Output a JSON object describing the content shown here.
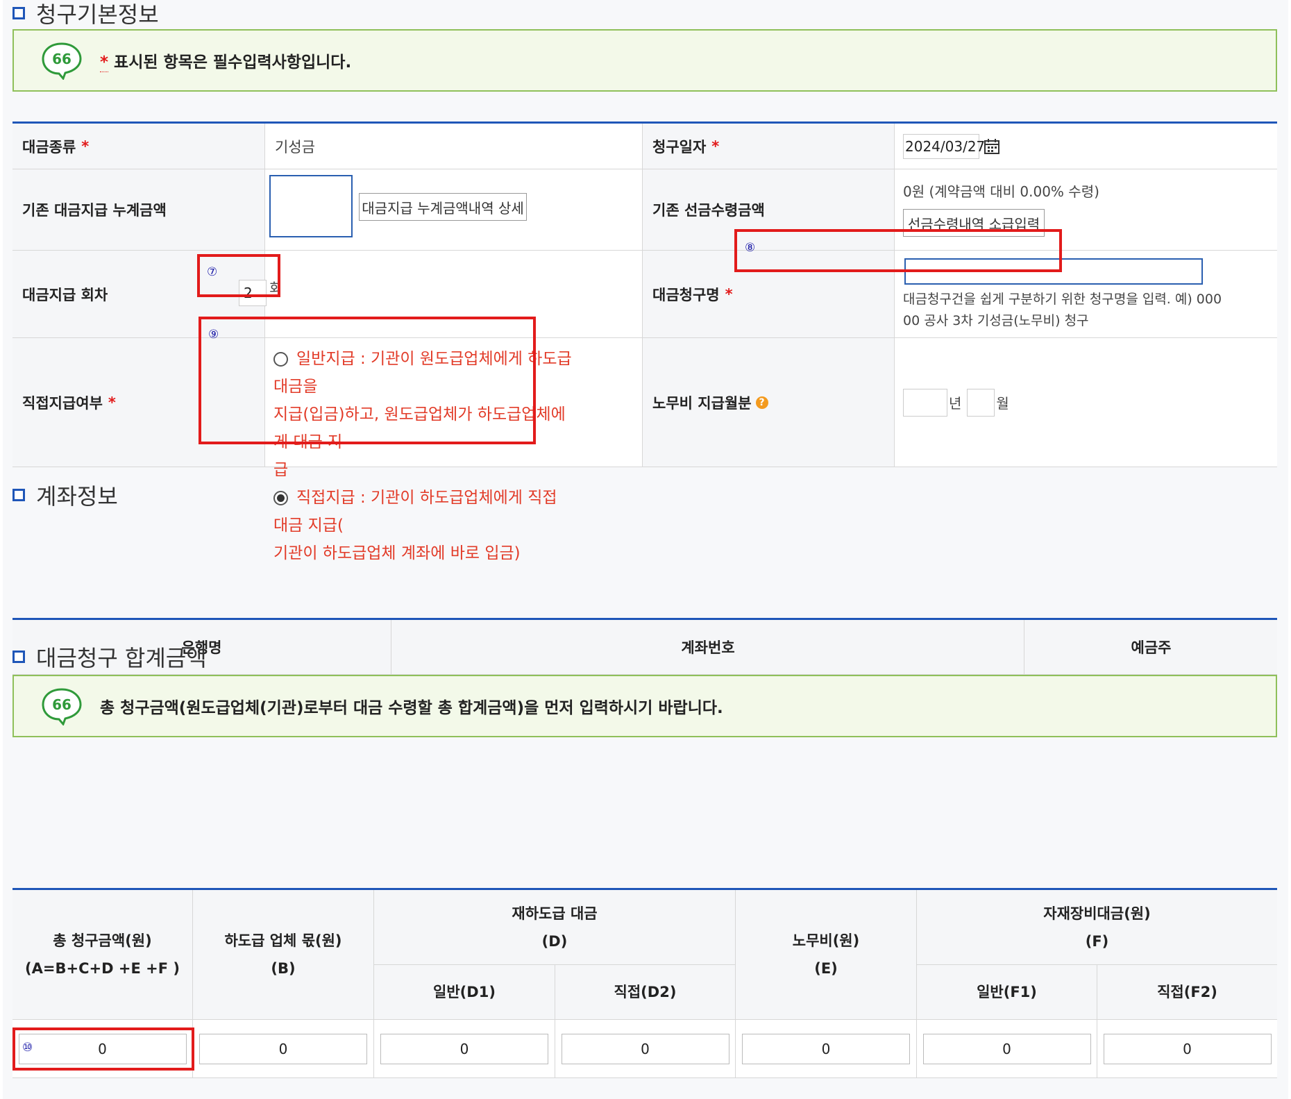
{
  "section1": {
    "title": "청구기본정보",
    "notice": {
      "star": "*",
      "text": "표시된 항목은 필수입력사항입니다."
    },
    "rows": {
      "type_label": "대금종류",
      "type_value": "기성금",
      "date_label": "청구일자",
      "date_value": "2024/03/27",
      "cum_label": "기존 대금지급 누계금액",
      "cum_button": "대금지급 누계금액내역 상세",
      "advance_label": "기존 선금수령금액",
      "advance_value": "0원 (계약금액 대비 0.00% 수령)",
      "advance_button": "선금수령내역 소급입력",
      "round_label": "대금지급 회차",
      "round_value": "2",
      "round_unit": "회",
      "claim_name_label": "대금청구명",
      "claim_name_help_1": "대금청구건을 쉽게 구분하기 위한 청구명을 입력. 예) 000",
      "claim_name_help_2": "00 공사 3차 기성금(노무비) 청구",
      "direct_label": "직접지급여부",
      "direct_opt1_a": "일반지급 : 기관이 원도급업체에게 하도급대금을",
      "direct_opt1_b": "지급(입금)하고, 원도급업체가 하도급업체에게 대금 지",
      "direct_opt1_c": "급",
      "direct_opt2_a": "직접지급 : 기관이 하도급업체에게 직접 대금 지급(",
      "direct_opt2_b": "기관이 하도급업체 계좌에 바로 입금)",
      "labor_label": "노무비 지급월분",
      "year_unit": "년",
      "month_unit": "월"
    },
    "markers": {
      "m7": "⑦",
      "m8": "⑧",
      "m9": "⑨"
    }
  },
  "section2": {
    "title": "계좌정보",
    "headers": [
      "은행명",
      "계좌번호",
      "예금주"
    ]
  },
  "section3": {
    "title": "대금청구 합계금액",
    "notice": "총 청구금액(원도급업체(기관)로부터 대금 수령할 총 합계금액)을 먼저 입력하시기 바랍니다.",
    "h_total_1": "총 청구금액(원)",
    "h_total_2": "(A=B+C+D +E +F )",
    "h_sub_1": "하도급 업체 몫(원)",
    "h_sub_2": "(B)",
    "h_resub_1": "재하도급 대금",
    "h_resub_2": "(D)",
    "h_d1": "일반(D1)",
    "h_d2": "직접(D2)",
    "h_labor_1": "노무비(원)",
    "h_labor_2": "(E)",
    "h_mat_1": "자재장비대금(원)",
    "h_mat_2": "(F)",
    "h_f1": "일반(F1)",
    "h_f2": "직접(F2)",
    "values": [
      "0",
      "0",
      "0",
      "0",
      "0",
      "0",
      "0"
    ],
    "marker": "⑩"
  },
  "colors": {
    "accent": "#1f56b8",
    "highlight": "#e21b1b",
    "notice_bg": "#f3f9e9",
    "notice_border": "#8fc05a"
  }
}
